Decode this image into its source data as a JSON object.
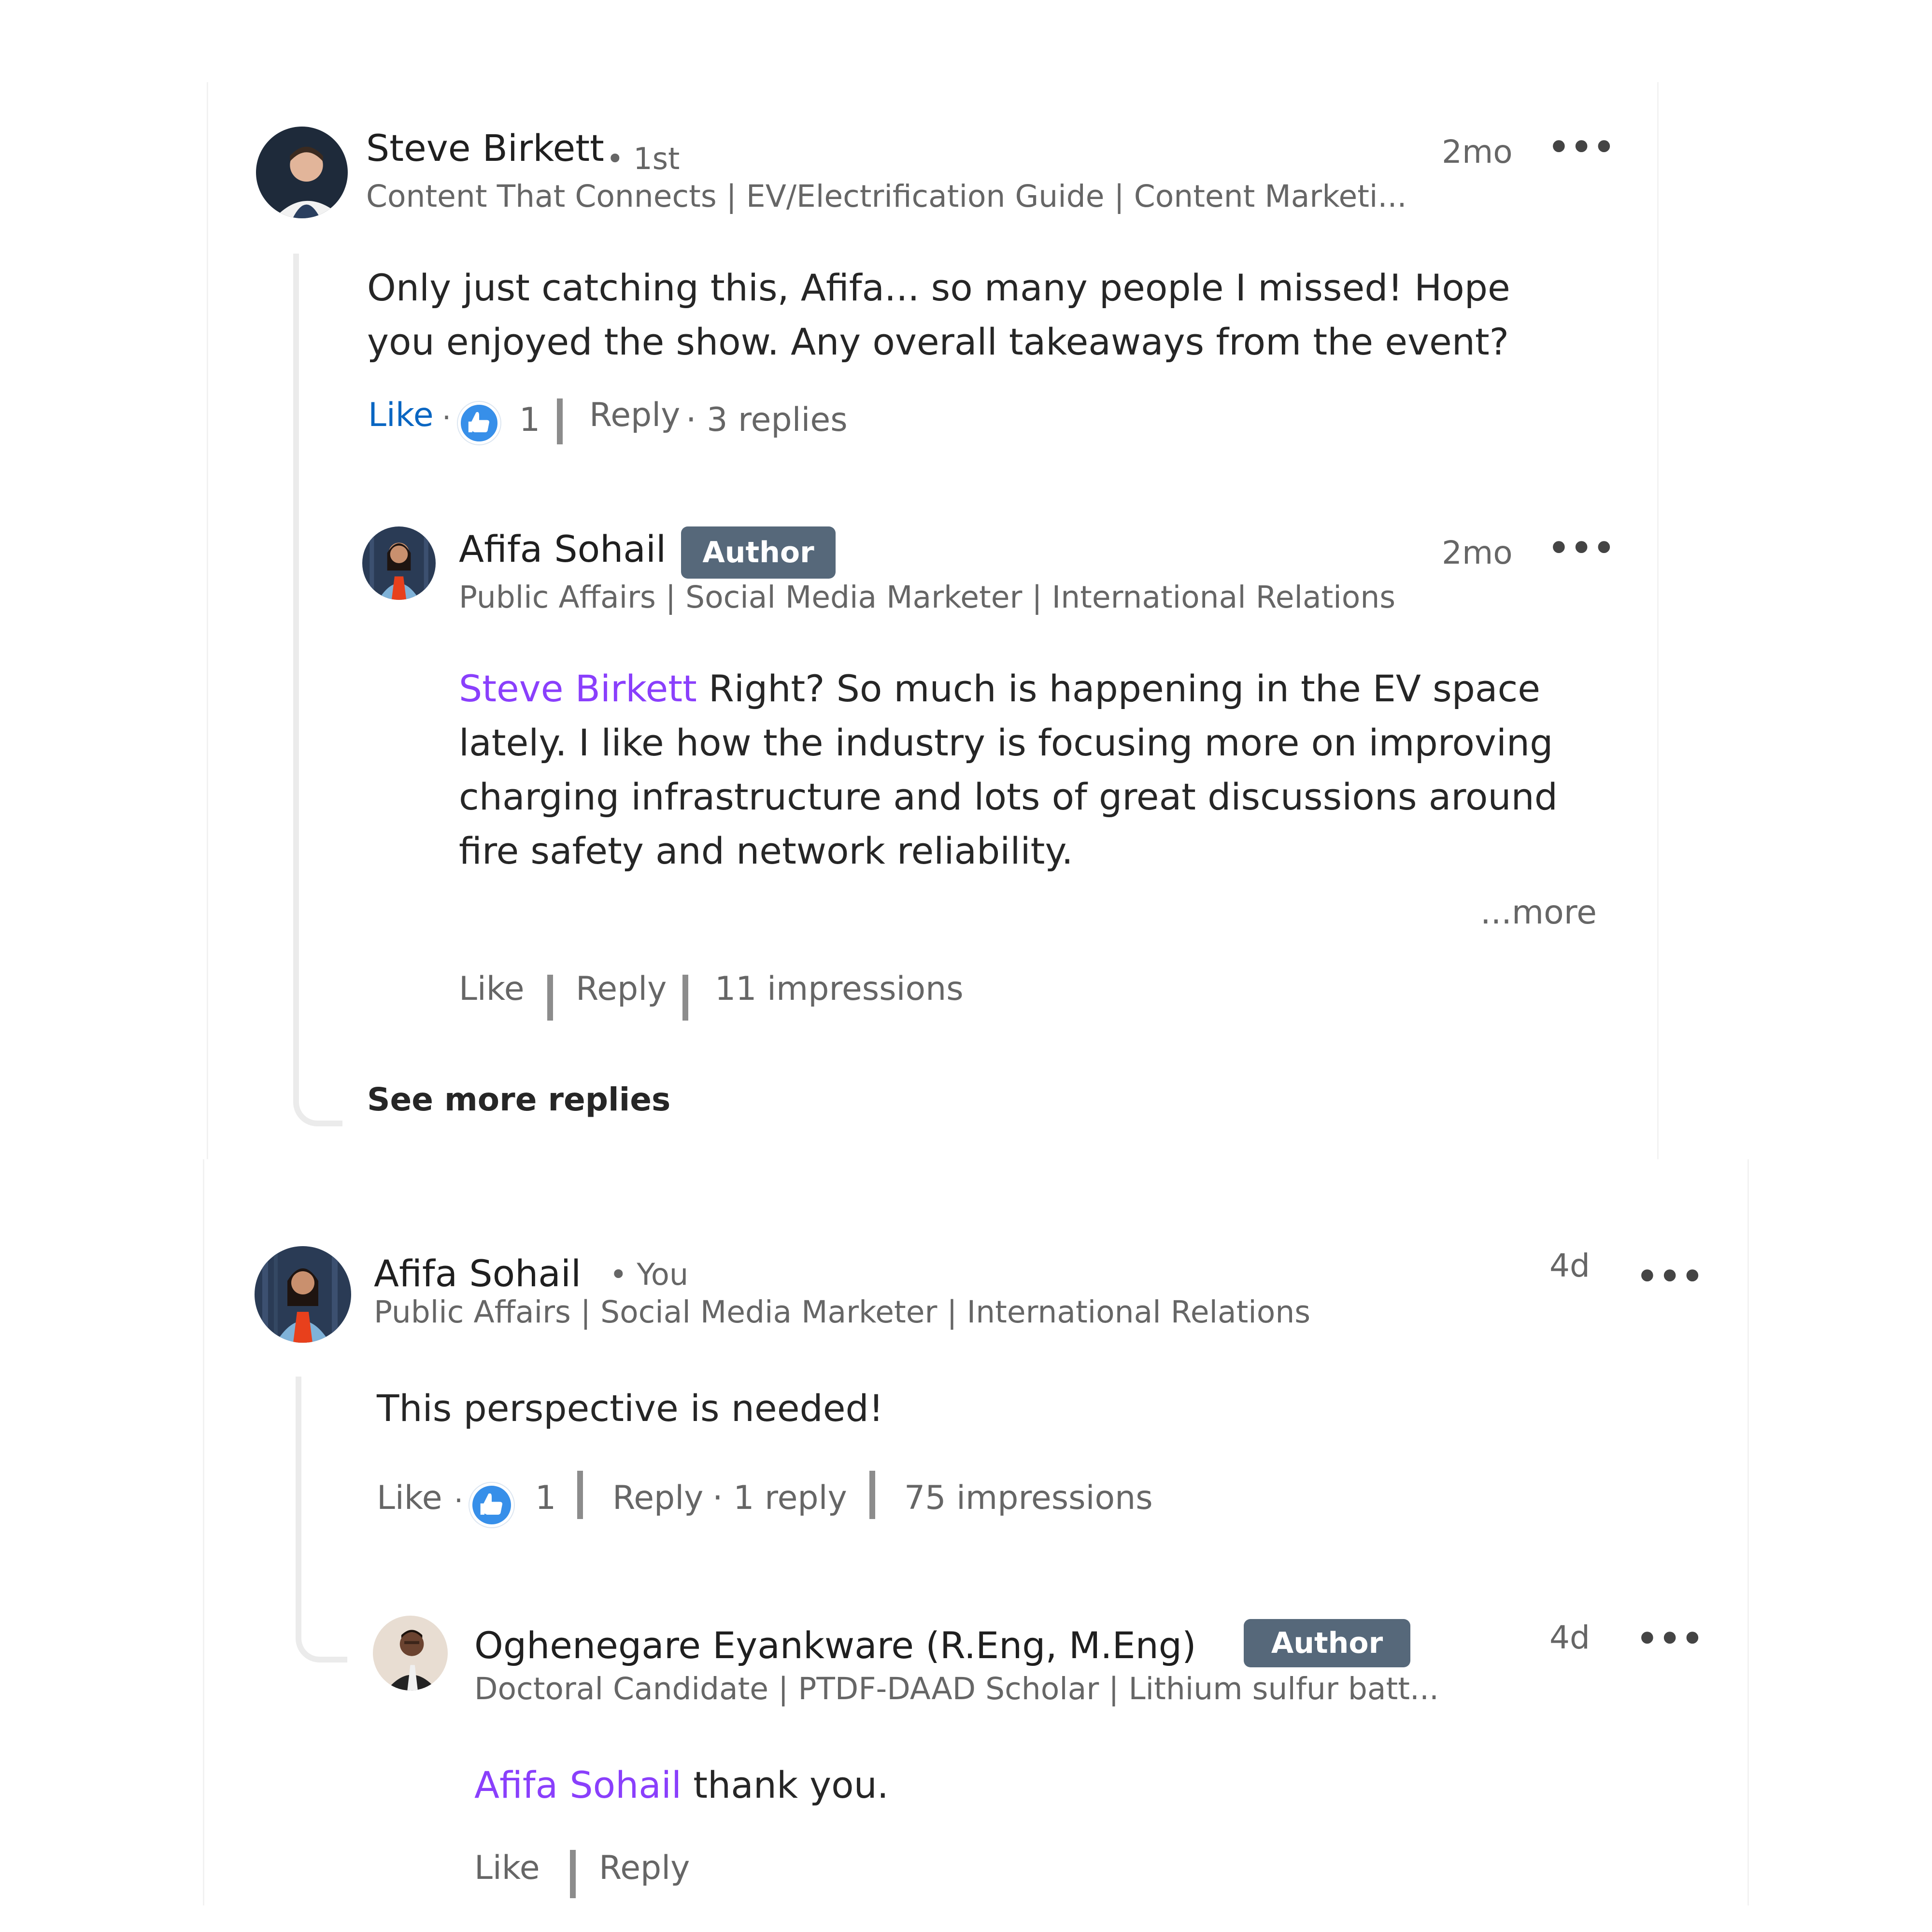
{
  "comments": [
    {
      "author": "Steve Birkett",
      "degree": "• 1st",
      "headline": "Content That Connects | EV/Electrification Guide | Content Marketi...",
      "time": "2mo",
      "text": "Only just catching this, Afifa... so many people I missed! Hope you enjoyed the show. Any overall takeaways from the event?",
      "like_label": "Like",
      "like_count": "1",
      "reply_label": "Reply",
      "reply_count": "· 3 replies",
      "replies": [
        {
          "author": "Afifa Sohail",
          "badge": "Author",
          "headline": "Public Affairs | Social Media Marketer | International Relations",
          "time": "2mo",
          "mention": "Steve Birkett",
          "text": "Right? So much is happening in the EV space lately. I like how the industry is focusing more on improving charging infrastructure and lots of great discussions around fire safety and network reliability.",
          "more_label": "...more",
          "like_label": "Like",
          "reply_label": "Reply",
          "impressions": "11 impressions"
        }
      ],
      "see_more_replies": "See more replies"
    },
    {
      "author": "Afifa Sohail",
      "degree": "• You",
      "headline": "Public Affairs | Social Media Marketer | International Relations",
      "time": "4d",
      "text": "This perspective is needed!",
      "like_label": "Like",
      "like_count": "1",
      "reply_label": "Reply",
      "reply_count": "· 1 reply",
      "impressions": "75 impressions",
      "replies": [
        {
          "author": "Oghenegare Eyankware (R.Eng, M.Eng)",
          "badge": "Author",
          "headline": "Doctoral Candidate | PTDF-DAAD Scholar | Lithium sulfur batt...",
          "time": "4d",
          "mention": "Afifa Sohail",
          "text": "thank you.",
          "like_label": "Like",
          "reply_label": "Reply"
        }
      ]
    }
  ],
  "icons": {
    "more": "•••",
    "reaction": "thumbs-up-icon"
  },
  "colors": {
    "like_active": "#0a66c2",
    "mention": "#8a3ffc",
    "badge_bg": "#56687a",
    "reaction_bg": "#378fe9"
  }
}
